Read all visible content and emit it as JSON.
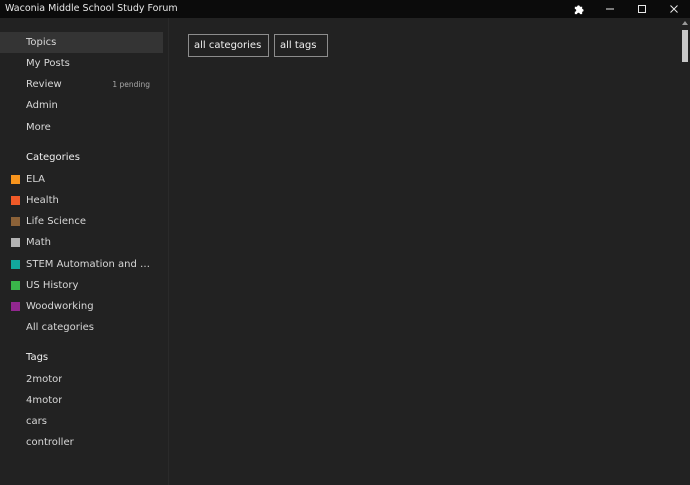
{
  "window": {
    "title": "Waconia Middle School Study Forum"
  },
  "nav": {
    "items": [
      {
        "label": "Topics",
        "active": true
      },
      {
        "label": "My Posts"
      },
      {
        "label": "Review",
        "badge": "1 pending"
      },
      {
        "label": "Admin"
      },
      {
        "label": "More"
      }
    ]
  },
  "categories": {
    "heading": "Categories",
    "items": [
      {
        "label": "ELA",
        "color": "#f7941d"
      },
      {
        "label": "Health",
        "color": "#f05a28"
      },
      {
        "label": "Life Science",
        "color": "#8c6238"
      },
      {
        "label": "Math",
        "color": "#b3b3b3"
      },
      {
        "label": "STEM Automation and Robotics",
        "color": "#12a89d"
      },
      {
        "label": "US History",
        "color": "#3ab54a"
      },
      {
        "label": "Woodworking",
        "color": "#92278f"
      }
    ],
    "all_label": "All categories"
  },
  "tags": {
    "heading": "Tags",
    "items": [
      "2motor",
      "4motor",
      "cars",
      "controller"
    ]
  },
  "filters": {
    "categories_label": "all categories",
    "tags_label": "all tags"
  }
}
